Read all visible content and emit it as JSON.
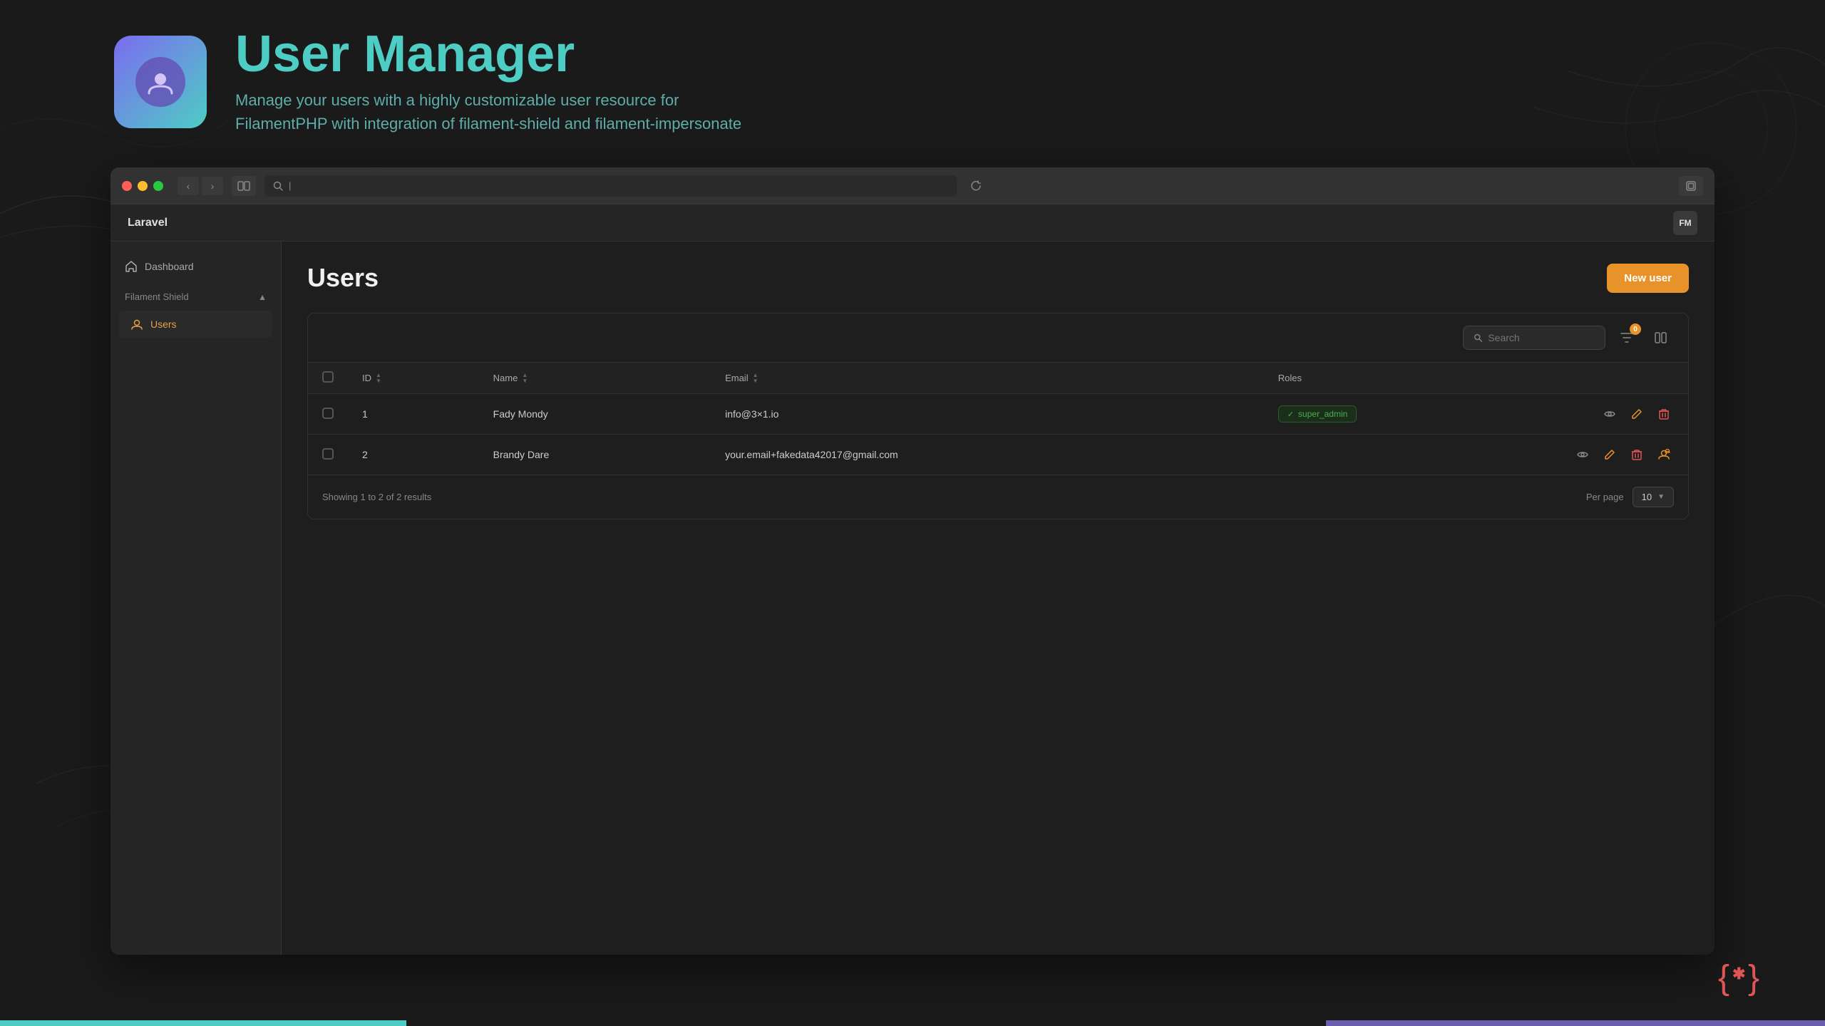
{
  "header": {
    "title": "User Manager",
    "subtitle_line1": "Manage your users with a highly customizable user resource for",
    "subtitle_line2": "FilamentPHP with integration of filament-shield and filament-impersonate"
  },
  "browser": {
    "address_placeholder": "",
    "app_name": "Laravel",
    "user_initials": "FM"
  },
  "sidebar": {
    "dashboard_label": "Dashboard",
    "section_label": "Filament Shield",
    "users_label": "Users"
  },
  "page": {
    "title": "Users",
    "new_user_btn": "New user"
  },
  "table": {
    "search_placeholder": "Search",
    "filter_badge": "0",
    "columns": {
      "id": "ID",
      "name": "Name",
      "email": "Email",
      "roles": "Roles"
    },
    "rows": [
      {
        "id": "1",
        "name": "Fady Mondy",
        "email": "info@3×1.io",
        "role": "super_admin",
        "has_role": true
      },
      {
        "id": "2",
        "name": "Brandy Dare",
        "email": "your.email+fakedata42017@gmail.com",
        "role": "",
        "has_role": false
      }
    ],
    "footer": {
      "showing_text": "Showing 1 to 2 of 2 results",
      "per_page_label": "Per page",
      "per_page_value": "10"
    }
  },
  "bottom_logo": "{*}"
}
